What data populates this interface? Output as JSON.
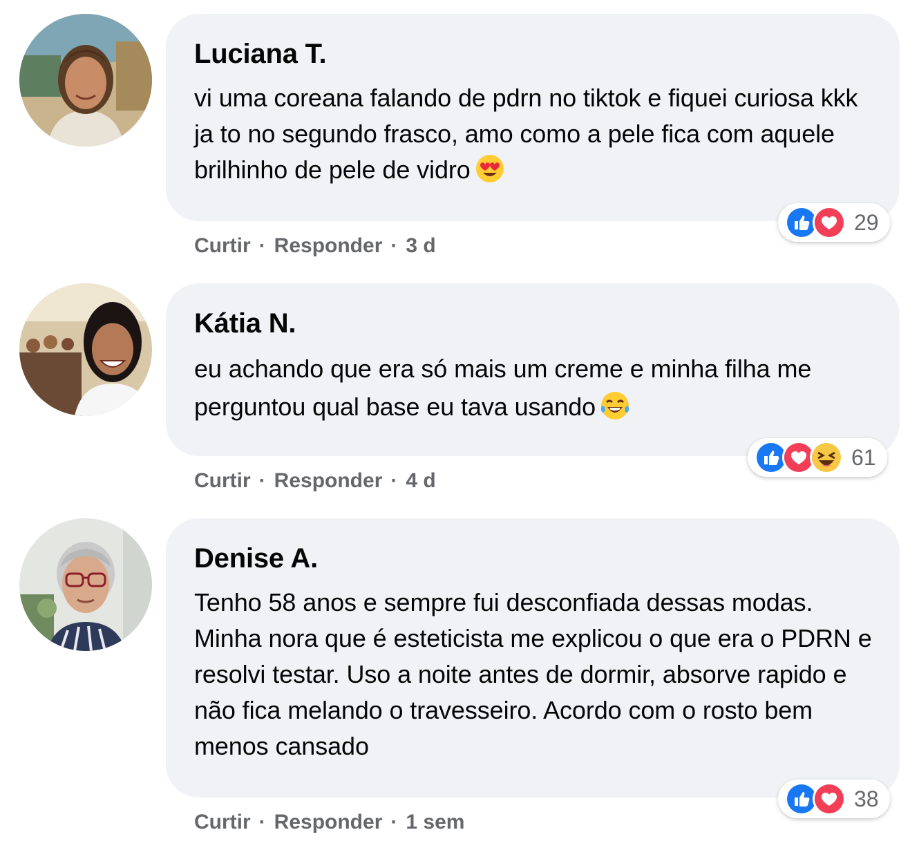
{
  "comments": [
    {
      "author": "Luciana T.",
      "text": "vi uma coreana falando de pdrn no tiktok e fiquei curiosa kkk ja to no segundo frasco, amo como a pele fica com aquele brilhinho de pele de vidro",
      "emoji": "heart-eyes-emoji",
      "like_label": "Curtir",
      "reply_label": "Responder",
      "time": "3 d",
      "reactions": [
        "like",
        "love"
      ],
      "reaction_count": "29"
    },
    {
      "author": "Kátia N.",
      "text": "eu achando que era só mais um creme e minha filha me perguntou qual base eu tava usando",
      "emoji": "tears-of-joy-emoji",
      "like_label": "Curtir",
      "reply_label": "Responder",
      "time": "4 d",
      "reactions": [
        "like",
        "love",
        "haha"
      ],
      "reaction_count": "61"
    },
    {
      "author": "Denise A.",
      "text": "Tenho 58 anos e sempre fui desconfiada dessas modas. Minha nora que é esteticista me explicou o que era o PDRN e resolvi testar. Uso a noite antes de dormir, absorve rapido e não fica melando o travesseiro. Acordo com o rosto bem menos cansado",
      "like_label": "Curtir",
      "reply_label": "Responder",
      "time": "1 sem",
      "reactions": [
        "like",
        "love"
      ],
      "reaction_count": "38"
    }
  ],
  "colors": {
    "bubble": "#f0f2f5",
    "like_blue": "#1877f2",
    "love_red": "#f33e58",
    "meta_gray": "#65676b"
  }
}
